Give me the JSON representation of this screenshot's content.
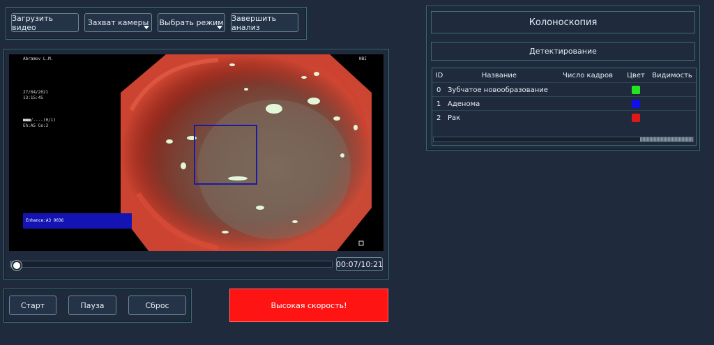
{
  "toolbar": {
    "load_video": "Загрузить видео",
    "camera_capture": "Захват камеры",
    "select_mode": "Выбрать режим",
    "finish_analysis": "Завершить анализ"
  },
  "video": {
    "overlay_name": "Abramov L.M.",
    "overlay_mode": "NBI",
    "overlay_date": "27/04/2021",
    "overlay_time": "13:15:45",
    "overlay_status": "■■■/----(0/1)\nEh:A5 Ce:3",
    "overlay_enhance": "Enhance:A3 9036",
    "time_display": "00:07/10:21",
    "progress_fraction": 0.01
  },
  "controls": {
    "start": "Старт",
    "pause": "Пауза",
    "reset": "Сброс",
    "speed_banner": "Высокая скорость!"
  },
  "right": {
    "mode_title": "Колоноскопия",
    "sub_title": "Детектирование",
    "table": {
      "headers": [
        "ID",
        "Название",
        "Число кадров",
        "Цвет",
        "Видимость"
      ],
      "rows": [
        {
          "id": "0",
          "name": "Зубчатое новообразование",
          "frames": "",
          "color": "#22e622",
          "visibility": ""
        },
        {
          "id": "1",
          "name": "Аденома",
          "frames": "",
          "color": "#1010ee",
          "visibility": ""
        },
        {
          "id": "2",
          "name": "Рак",
          "frames": "",
          "color": "#e11818",
          "visibility": ""
        }
      ]
    }
  },
  "colors": {
    "background": "#1f2b3d",
    "panel_border": "#3a6f73",
    "speed_banner": "#ff1414",
    "detection_box": "#1a1aa8"
  }
}
